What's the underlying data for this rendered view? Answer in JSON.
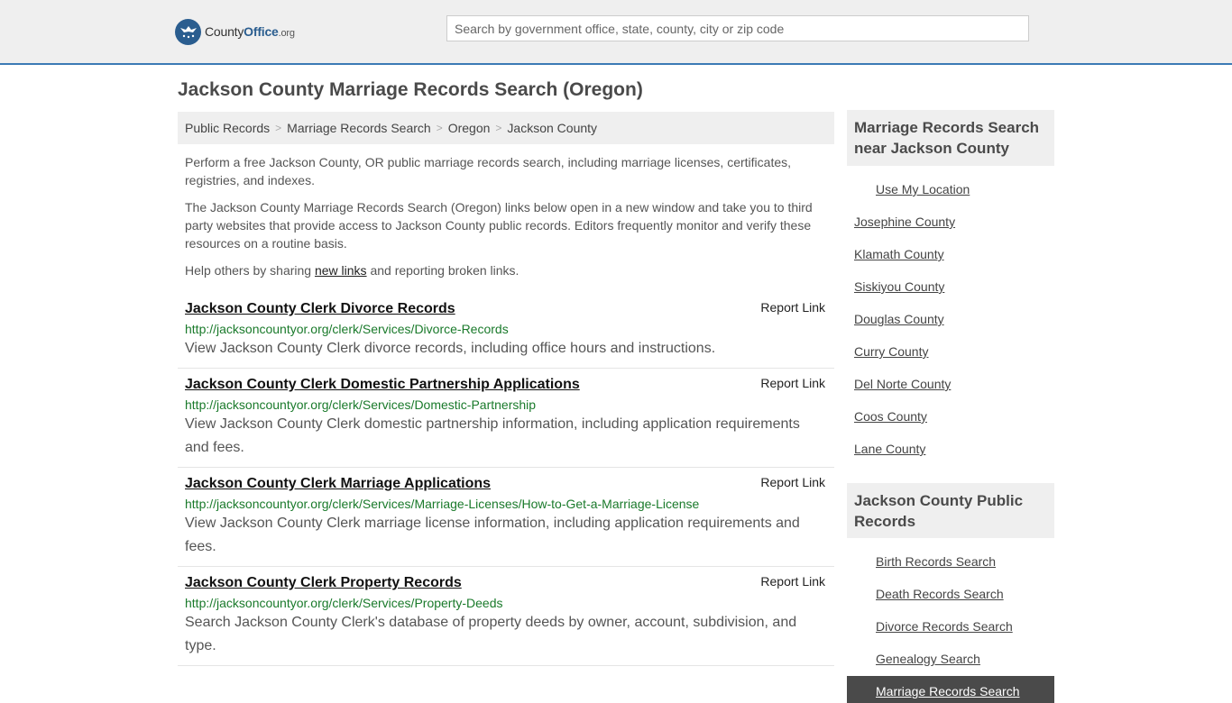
{
  "header": {
    "logo": {
      "text_main": "County",
      "text_brand": "Office",
      "text_tld": ".org"
    },
    "search_placeholder": "Search by government office, state, county, city or zip code"
  },
  "page": {
    "title": "Jackson County Marriage Records Search (Oregon)",
    "breadcrumb": [
      "Public Records",
      "Marriage Records Search",
      "Oregon",
      "Jackson County"
    ],
    "intro1": "Perform a free Jackson County, OR public marriage records search, including marriage licenses, certificates, registries, and indexes.",
    "intro2": "The Jackson County Marriage Records Search (Oregon) links below open in a new window and take you to third party websites that provide access to Jackson County public records. Editors frequently monitor and verify these resources on a routine basis.",
    "intro3_before": "Help others by sharing ",
    "intro3_link": "new links",
    "intro3_after": " and reporting broken links."
  },
  "results": [
    {
      "title": "Jackson County Clerk Divorce Records",
      "url": "http://jacksoncountyor.org/clerk/Services/Divorce-Records",
      "desc": "View Jackson County Clerk divorce records, including office hours and instructions.",
      "report": "Report Link"
    },
    {
      "title": "Jackson County Clerk Domestic Partnership Applications",
      "url": "http://jacksoncountyor.org/clerk/Services/Domestic-Partnership",
      "desc": "View Jackson County Clerk domestic partnership information, including application requirements and fees.",
      "report": "Report Link"
    },
    {
      "title": "Jackson County Clerk Marriage Applications",
      "url": "http://jacksoncountyor.org/clerk/Services/Marriage-Licenses/How-to-Get-a-Marriage-License",
      "desc": "View Jackson County Clerk marriage license information, including application requirements and fees.",
      "report": "Report Link"
    },
    {
      "title": "Jackson County Clerk Property Records",
      "url": "http://jacksoncountyor.org/clerk/Services/Property-Deeds",
      "desc": "Search Jackson County Clerk's database of property deeds by owner, account, subdivision, and type.",
      "report": "Report Link"
    }
  ],
  "sidebar": {
    "nearby_title": "Marriage Records Search near Jackson County",
    "use_location": "Use My Location",
    "nearby": [
      "Josephine County",
      "Klamath County",
      "Siskiyou County",
      "Douglas County",
      "Curry County",
      "Del Norte County",
      "Coos County",
      "Lane County"
    ],
    "public_title": "Jackson County Public Records",
    "public_links": [
      "Birth Records Search",
      "Death Records Search",
      "Divorce Records Search",
      "Genealogy Search"
    ],
    "active_link": "Marriage Records Search"
  }
}
